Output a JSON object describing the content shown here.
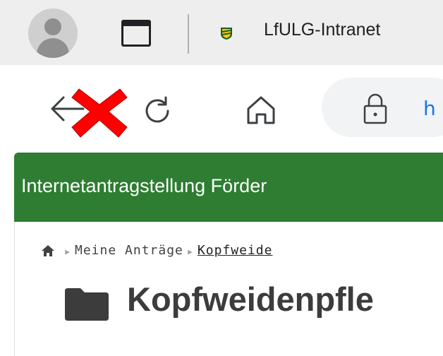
{
  "browser": {
    "tab_title": "LfULG-Intranet",
    "url_start": "h"
  },
  "app": {
    "header_title": "Internetantragstellung Förder"
  },
  "breadcrumb": {
    "items": [
      "Meine Anträge",
      "Kopfweide"
    ]
  },
  "page": {
    "title": "Kopfweidenpfle"
  },
  "colors": {
    "header_green": "#2e7d32",
    "overlay_red": "#ff0000"
  },
  "icons": {
    "profile": "profile-avatar-icon",
    "tab_switcher": "tab-switcher-icon",
    "back": "back-arrow-icon",
    "error_overlay": "red-x-icon",
    "reload": "reload-icon",
    "home": "home-icon",
    "lock": "lock-icon",
    "breadcrumb_home": "home-icon",
    "folder": "folder-icon"
  }
}
